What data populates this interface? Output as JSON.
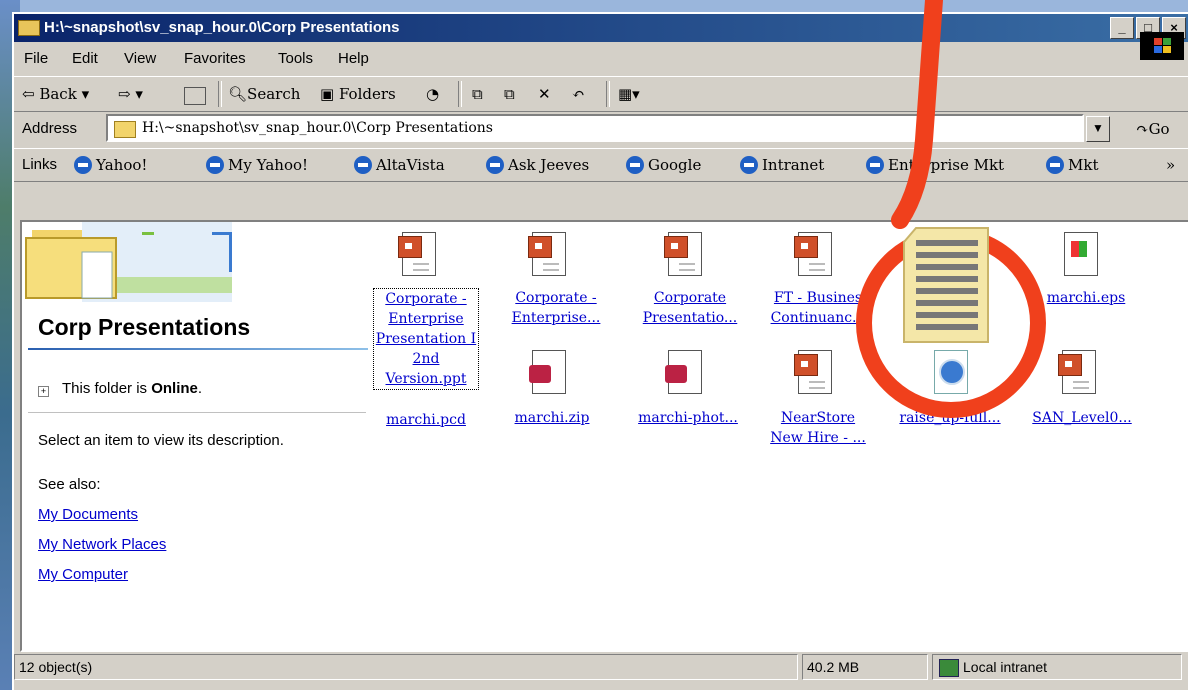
{
  "window": {
    "title": "H:\\~snapshot\\sv_snap_hour.0\\Corp Presentations"
  },
  "menu": [
    "File",
    "Edit",
    "View",
    "Favorites",
    "Tools",
    "Help"
  ],
  "toolbar": {
    "back": "Back",
    "search": "Search",
    "folders": "Folders"
  },
  "address": {
    "label": "Address",
    "value": "H:\\~snapshot\\sv_snap_hour.0\\Corp Presentations",
    "go": "Go"
  },
  "links": {
    "label": "Links",
    "items": [
      "Yahoo!",
      "My Yahoo!",
      "AltaVista",
      "Ask Jeeves",
      "Google",
      "Intranet",
      "Enterprise Mkt",
      "Mkt"
    ],
    "more": "»"
  },
  "pane": {
    "title": "Corp Presentations",
    "online_prefix": "This folder is ",
    "online_bold": "Online",
    "online_suffix": ".",
    "description": "Select an item to view its description.",
    "see_also": "See also:",
    "links": [
      "My Documents",
      "My Network Places",
      "My Computer"
    ]
  },
  "files": [
    {
      "name": "Corporate - Enterprise Presentation I 2nd Version.ppt",
      "line1": "Corporate -",
      "line2": "Enterprise",
      "line3": "Presentation I",
      "line4": "2nd",
      "line5": "Version.ppt",
      "icon": "powerpoint-file-icon"
    },
    {
      "name": "Corporate - Enterprise...",
      "line1": "Corporate -",
      "line2": "Enterprise...",
      "icon": "powerpoint-file-icon"
    },
    {
      "name": "Corporate Presentatio...",
      "line1": "Corporate",
      "line2": "Presentatio...",
      "icon": "powerpoint-file-icon"
    },
    {
      "name": "FT - Business Continuanc...",
      "line1": "FT - Busines",
      "line2": "Continuanc...",
      "icon": "powerpoint-file-icon"
    },
    {
      "name": "marchi.eps",
      "line1": "marchi.eps",
      "icon": "eps-file-icon"
    },
    {
      "name": "marchi.pcd",
      "line1": "marchi.pcd",
      "icon": "pcd-file-icon"
    },
    {
      "name": "marchi.zip",
      "line1": "marchi.zip",
      "icon": "zip-file-icon"
    },
    {
      "name": "marchi-phot...",
      "line1": "marchi-phot...",
      "icon": "zip-file-icon"
    },
    {
      "name": "NearStore New Hire - ...",
      "line1": "NearStore",
      "line2": "New Hire - ...",
      "icon": "powerpoint-file-icon"
    },
    {
      "name": "raise_up-full...",
      "line1": "raise_up-full...",
      "icon": "media-file-icon"
    },
    {
      "name": "SAN_Level0...",
      "line1": "SAN_Level0...",
      "icon": "powerpoint-file-icon"
    }
  ],
  "status": {
    "objects": "12 object(s)",
    "size": "40.2 MB",
    "zone": "Local intranet"
  },
  "colors": {
    "titlebar": "#0a246a",
    "callout": "#f0401c",
    "link": "#0000cc"
  }
}
